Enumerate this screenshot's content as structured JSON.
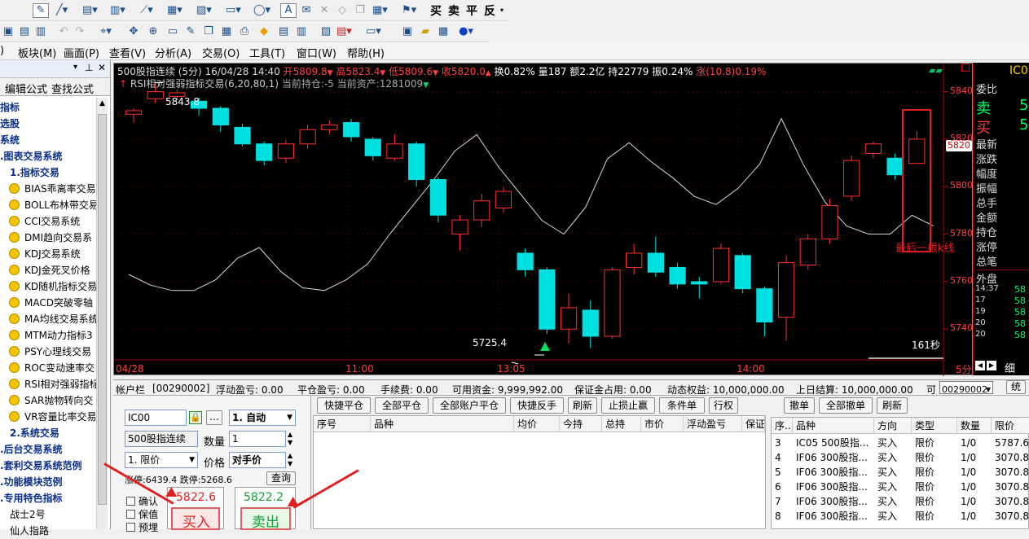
{
  "toolbar1": {
    "trade_chars": [
      "买",
      "卖",
      "平",
      "反"
    ]
  },
  "menu": [
    "板块(M)",
    "画面(P)",
    "查看(V)",
    "分析(A)",
    "交易(O)",
    "工具(T)",
    "窗口(W)",
    "帮助(H)"
  ],
  "menu_first": ")",
  "tree": {
    "tabs": [
      "编辑公式",
      "查找公式"
    ],
    "items": [
      {
        "label": "指标",
        "kind": "folder",
        "indent": 0
      },
      {
        "label": "选股",
        "kind": "folder",
        "indent": 0
      },
      {
        "label": "系统",
        "kind": "folder",
        "indent": 0
      },
      {
        "label": ".图表交易系统",
        "kind": "folder",
        "indent": 0
      },
      {
        "label": "1.指标交易",
        "kind": "folder",
        "indent": 12
      },
      {
        "label": "BIAS乖离率交易",
        "kind": "leaf"
      },
      {
        "label": "BOLL布林带交易",
        "kind": "leaf"
      },
      {
        "label": "CCI交易系统",
        "kind": "leaf"
      },
      {
        "label": "DMI趋向交易系",
        "kind": "leaf"
      },
      {
        "label": "KDJ交易系统",
        "kind": "leaf"
      },
      {
        "label": "KDJ金死叉价格",
        "kind": "leaf"
      },
      {
        "label": "KD随机指标交易",
        "kind": "leaf"
      },
      {
        "label": "MACD突破零轴",
        "kind": "leaf"
      },
      {
        "label": "MA均线交易系统",
        "kind": "leaf"
      },
      {
        "label": "MTM动力指标3",
        "kind": "leaf"
      },
      {
        "label": "PSY心理线交易",
        "kind": "leaf"
      },
      {
        "label": "ROC变动速率交",
        "kind": "leaf"
      },
      {
        "label": "RSI相对强弱指标",
        "kind": "leaf"
      },
      {
        "label": "SAR抛物转向交",
        "kind": "leaf"
      },
      {
        "label": "VR容量比率交易",
        "kind": "leaf"
      },
      {
        "label": "2.系统交易",
        "kind": "folder",
        "indent": 12
      },
      {
        "label": ".后台交易系统",
        "kind": "folder",
        "indent": 0
      },
      {
        "label": ".套利交易系统范例",
        "kind": "folder",
        "indent": 0
      },
      {
        "label": ".功能模块范例",
        "kind": "folder",
        "indent": 0
      },
      {
        "label": ".专用特色指标",
        "kind": "folder",
        "indent": 0
      },
      {
        "label": "战士2号",
        "kind": "plain"
      },
      {
        "label": "仙人指路",
        "kind": "plain"
      }
    ]
  },
  "chart": {
    "title": "500股指连续 (5分) 16/04/28 14:40",
    "open": "开5809.8",
    "high": "高5823.4",
    "low": "低5809.6",
    "close": "收5820.0",
    "chg_turn": "换0.82%",
    "vol": "量187",
    "amt": "额2.2亿",
    "hold": "持22779",
    "amp": "振0.24%",
    "rise": "涨(10.8)0.19%",
    "line2": "RSI相对强弱指标交易(6,20,80,1)",
    "pos": "当前持仓:-5",
    "asset": "当前资产:1281009",
    "high_label": "5843.8",
    "low_label": "5725.4",
    "seconds": "161秒",
    "annotation": "最后一根k线",
    "price_tag": "5820",
    "y_labels": [
      "5840",
      "5820",
      "5800",
      "5780",
      "5760",
      "5740"
    ],
    "x_labels": [
      "04/28",
      "11:00",
      "13:05",
      "14:00"
    ],
    "scroll_label": "5分"
  },
  "chart_data": {
    "type": "candlestick",
    "ylim": [
      5725,
      5845
    ],
    "candles": [
      [
        5830.5,
        5832.0,
        5833.0,
        5827.0
      ],
      [
        5837.0,
        5840.0,
        5843.8,
        5835.0
      ],
      [
        5838.0,
        5839.5,
        5841.0,
        5836.5
      ],
      [
        5836.0,
        5833.0,
        5837.5,
        5830.0
      ],
      [
        5833.0,
        5826.0,
        5834.0,
        5823.0
      ],
      [
        5825.0,
        5818.0,
        5826.5,
        5817.0
      ],
      [
        5818.0,
        5811.0,
        5819.0,
        5809.0
      ],
      [
        5812.0,
        5818.0,
        5819.5,
        5810.0
      ],
      [
        5818.0,
        5824.0,
        5826.0,
        5816.0
      ],
      [
        5824.0,
        5826.0,
        5828.0,
        5822.0
      ],
      [
        5827.0,
        5821.0,
        5828.5,
        5819.0
      ],
      [
        5820.0,
        5813.0,
        5821.0,
        5811.0
      ],
      [
        5812.0,
        5818.0,
        5822.0,
        5811.0
      ],
      [
        5818.0,
        5803.0,
        5819.0,
        5800.0
      ],
      [
        5803.0,
        5788.0,
        5804.0,
        5785.0
      ],
      [
        5780.0,
        5786.0,
        5788.0,
        5773.0
      ],
      [
        5786.0,
        5794.0,
        5797.0,
        5783.0
      ],
      [
        5791.0,
        5798.0,
        5800.0,
        5789.0
      ],
      [
        5772.0,
        5765.0,
        5774.0,
        5762.0
      ],
      [
        5765.0,
        5740.0,
        5766.0,
        5738.0
      ],
      [
        5740.0,
        5749.0,
        5755.0,
        5734.0
      ],
      [
        5748.0,
        5737.0,
        5752.0,
        5732.0
      ],
      [
        5737.0,
        5765.0,
        5766.0,
        5736.0
      ],
      [
        5766.0,
        5772.0,
        5776.0,
        5763.0
      ],
      [
        5772.0,
        5764.0,
        5779.0,
        5762.0
      ],
      [
        5766.0,
        5759.0,
        5768.0,
        5757.0
      ],
      [
        5760.0,
        5759.0,
        5762.0,
        5753.0
      ],
      [
        5760.0,
        5774.0,
        5776.0,
        5759.0
      ],
      [
        5771.0,
        5757.0,
        5772.0,
        5755.0
      ],
      [
        5757.0,
        5743.0,
        5758.0,
        5737.0
      ],
      [
        5745.0,
        5768.0,
        5771.0,
        5735.0
      ],
      [
        5767.0,
        5778.0,
        5780.0,
        5765.0
      ],
      [
        5778.0,
        5792.0,
        5795.0,
        5776.0
      ],
      [
        5796.0,
        5811.0,
        5813.0,
        5794.0
      ],
      [
        5814.0,
        5818.0,
        5819.0,
        5812.0
      ],
      [
        5812.0,
        5805.0,
        5814.0,
        5803.0
      ],
      [
        5809.8,
        5820.0,
        5823.4,
        5809.6
      ]
    ],
    "rsi_line": [
      30,
      26,
      24,
      24,
      28,
      36,
      40,
      31,
      25,
      24,
      28,
      34,
      45,
      55,
      65,
      76,
      82,
      70,
      60,
      50,
      45,
      55,
      73,
      79,
      72,
      66,
      59,
      56,
      62,
      71,
      88,
      71,
      57,
      48,
      45,
      45,
      52,
      48
    ]
  },
  "account": {
    "label": "帐户栏",
    "id": "[00290002]",
    "float_pl": "浮动盈亏: 0.00",
    "close_pl": "平仓盈亏: 0.00",
    "fee": "手续费: 0.00",
    "avail": "可用资金: 9,999,992.00",
    "margin": "保证金占用: 0.00",
    "equity": "动态权益: 10,000,000.00",
    "last": "上日结算: 10,000,000.00",
    "more": "可",
    "select": "00290002",
    "right_btn": "统"
  },
  "order": {
    "code": "IC00",
    "lock": "…",
    "mode": "1. 自动",
    "name": "500股指连续",
    "qty_label": "数量",
    "qty": "1",
    "type": "1. 限价",
    "price_label": "价格",
    "price": "对手价",
    "limits": "涨停:6439.4 跌停:5268.6",
    "reset": "查询",
    "confirm": "确认",
    "keep": "保值",
    "preset": "预埋",
    "buy_price": "5822.6",
    "buy_label": "买入",
    "sell_price": "5822.2",
    "sell_label": "卖出"
  },
  "pos_buttons": [
    "快捷平仓",
    "全部平仓",
    "全部账户平仓",
    "快捷反手",
    "刷新",
    "止损止赢",
    "条件单",
    "行权"
  ],
  "pos_headers": [
    "序号",
    "品种",
    "均价",
    "今持",
    "总持",
    "市价",
    "浮动盈亏",
    "保证"
  ],
  "ord_buttons": [
    "撤单",
    "全部撤单",
    "刷新"
  ],
  "ord_headers": [
    "序...",
    "品种",
    "方向",
    "类型",
    "数量",
    "限价"
  ],
  "orders": [
    [
      "3",
      "IC05 500股指...",
      "买入",
      "限价",
      "1/0",
      "5787.6"
    ],
    [
      "4",
      "IF06 300股指...",
      "买入",
      "限价",
      "1/0",
      "3070.8"
    ],
    [
      "5",
      "IF06 300股指...",
      "买入",
      "限价",
      "1/0",
      "3070.8"
    ],
    [
      "6",
      "IF06 300股指...",
      "买入",
      "限价",
      "1/0",
      "3070.8"
    ],
    [
      "7",
      "IF06 300股指...",
      "买入",
      "限价",
      "1/0",
      "3070.8"
    ],
    [
      "8",
      "IF06 300股指...",
      "买入",
      "限价",
      "1/0",
      "3070.8"
    ]
  ],
  "quote": {
    "code": "IC0",
    "ratio": "委比",
    "sell": "卖",
    "sell_v": "5",
    "buy": "买",
    "buy_v": "5",
    "labels": [
      "最新",
      "涨跌",
      "幅度",
      "振幅",
      "总手",
      "金额",
      "持仓",
      "涨停",
      "总笔"
    ],
    "outer": "外盘",
    "detail": "细",
    "ticks": [
      [
        "14:37",
        "58"
      ],
      [
        "17",
        "58"
      ],
      [
        "19",
        "58"
      ],
      [
        "20",
        "58"
      ],
      [
        "20",
        "58"
      ]
    ]
  },
  "colors": {
    "up": "#ff3030",
    "down": "#00e0e0",
    "label_red": "#ff4040",
    "label_green": "#00ff60"
  }
}
